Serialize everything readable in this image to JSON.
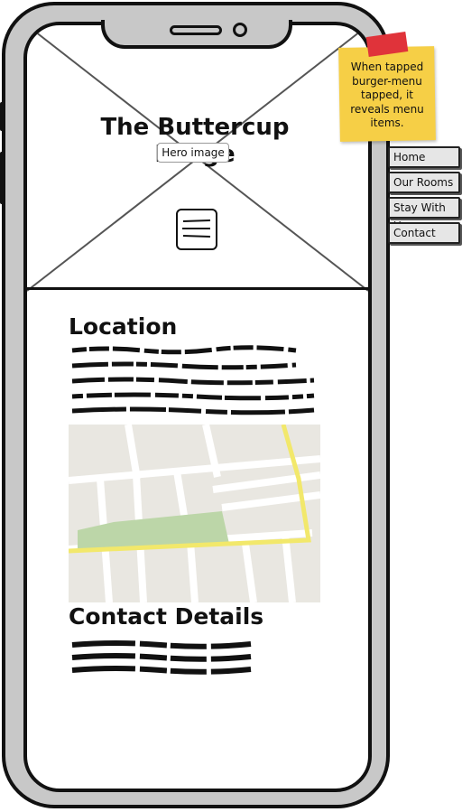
{
  "hero": {
    "title": "The Buttercup Lodge",
    "image_label": "Hero image",
    "menu_icon": "burger-menu-icon"
  },
  "location": {
    "heading": "Location",
    "text_placeholder_lines": 5,
    "map_icon": "map-image"
  },
  "contact": {
    "heading": "Contact Details",
    "text_placeholder_lines": 3
  },
  "annotation": {
    "text": "When tapped burger-menu tapped, it reveals menu items."
  },
  "menu": {
    "items": [
      {
        "label": "Home"
      },
      {
        "label": "Our Rooms"
      },
      {
        "label": "Stay With Us"
      },
      {
        "label": "Contact"
      }
    ]
  },
  "colors": {
    "sticky_note": "#f6cf46",
    "tape": "#e0333a",
    "phone_frame": "#c8c8c8",
    "map_road_highlight": "#f2e86b",
    "map_park": "#bcd6a8"
  }
}
